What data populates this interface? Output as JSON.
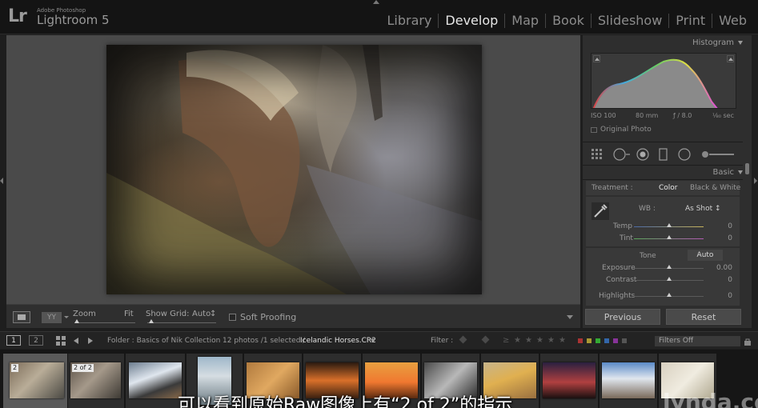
{
  "app": {
    "logo_mark": "Lr",
    "vendor": "Adobe Photoshop",
    "name": "Lightroom 5"
  },
  "modules": [
    {
      "label": "Library",
      "active": false
    },
    {
      "label": "Develop",
      "active": true
    },
    {
      "label": "Map",
      "active": false
    },
    {
      "label": "Book",
      "active": false
    },
    {
      "label": "Slideshow",
      "active": false
    },
    {
      "label": "Print",
      "active": false
    },
    {
      "label": "Web",
      "active": false
    }
  ],
  "toolbar": {
    "yy_label": "YY",
    "zoom_label": "Zoom",
    "zoom_value": "Fit",
    "grid_label": "Show Grid:",
    "grid_value": "Auto",
    "grid_drop": "↕",
    "soft_proofing": "Soft Proofing"
  },
  "histogram": {
    "header": "Histogram",
    "iso": "ISO 100",
    "focal": "80 mm",
    "aperture": "ƒ / 8.0",
    "shutter": "¹⁄₈₀ sec",
    "original_photo": "Original Photo"
  },
  "basic": {
    "header": "Basic",
    "treatment_label": "Treatment :",
    "treatment_color": "Color",
    "treatment_bw": "Black & White",
    "wb_label": "WB :",
    "wb_value": "As Shot ↕",
    "tone_label": "Tone",
    "auto_label": "Auto",
    "sliders": [
      {
        "label": "Temp",
        "value": "0",
        "position": 0.5
      },
      {
        "label": "Tint",
        "value": "0",
        "position": 0.5
      },
      {
        "label": "Exposure",
        "value": "0.00",
        "position": 0.5
      },
      {
        "label": "Contrast",
        "value": "0",
        "position": 0.5
      },
      {
        "label": "Highlights",
        "value": "0",
        "position": 0.5
      }
    ]
  },
  "buttons": {
    "previous": "Previous",
    "reset": "Reset"
  },
  "filmbar": {
    "view1": "1",
    "view2": "2",
    "folder_prefix": "Folder : Basics of Nik Collection",
    "photo_count": "12 photos /1 selected /",
    "filename": "Icelandic Horses.CR2",
    "filename_drop": "▾",
    "filter_label": "Filter :",
    "filter_value": "Filters Off",
    "star_glyph": "★",
    "gte_glyph": "≥"
  },
  "filmstrip": {
    "badge_1": "2",
    "badge_2": "2 of 2"
  },
  "caption": "可以看到原始Raw图像上有“2 of 2”的指示",
  "watermark": "lynda.com",
  "colors": {
    "background": "#1e1e1e",
    "panel": "#2e2e2e",
    "active_module": "#e6e6e6",
    "inactive_module": "#8c8c8c"
  },
  "icons": {
    "grid_tool": "crop-overlay-icon",
    "spot": "spot-removal-icon",
    "redeye": "red-eye-icon",
    "gradient": "graduated-filter-icon",
    "radial": "radial-filter-icon",
    "brush": "adjustment-brush-icon",
    "eyedropper": "eyedropper-icon"
  }
}
